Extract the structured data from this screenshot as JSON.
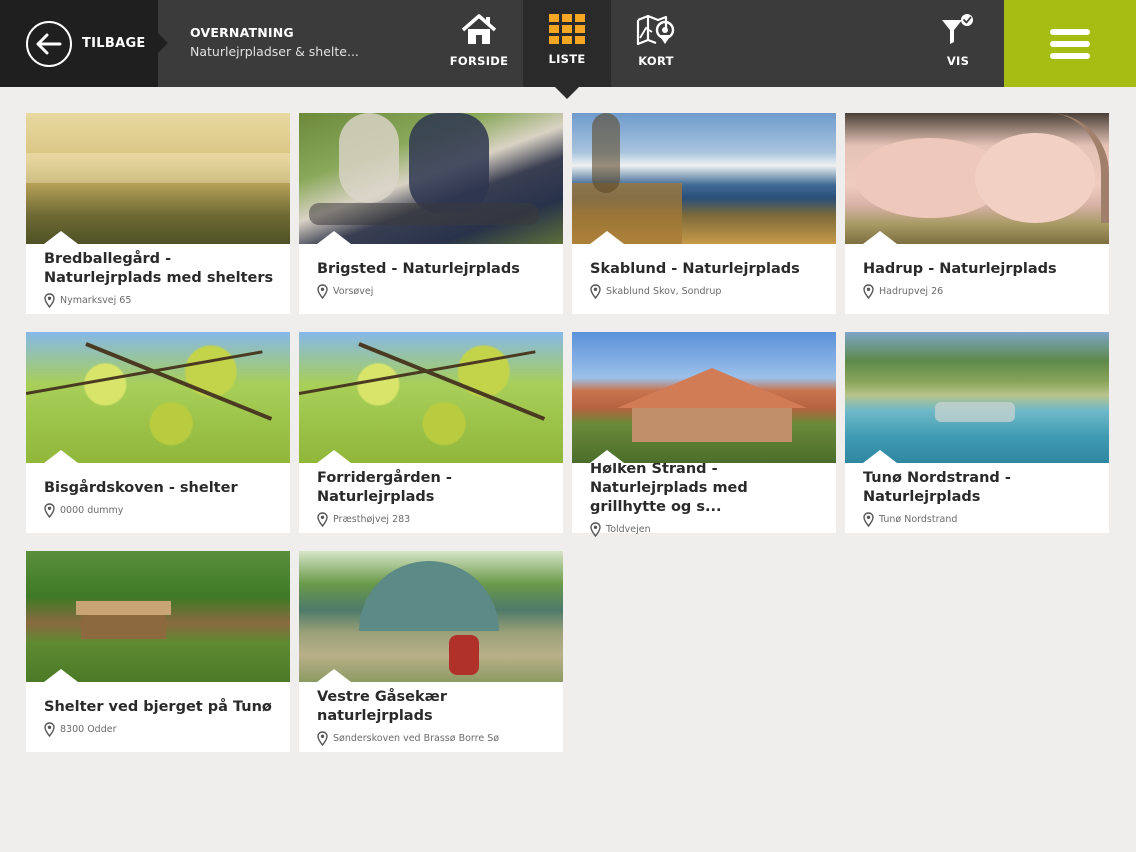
{
  "header": {
    "back_label": "TILBAGE",
    "title": "OVERNATNING",
    "subtitle": "Naturlejrpladser & shelte...",
    "nav": {
      "home": "FORSIDE",
      "list": "LISTE",
      "map": "KORT",
      "filter": "VIS"
    }
  },
  "colors": {
    "header_bg": "#3b3b3b",
    "accent": "#a6bd14",
    "list_active": "#f5a623"
  },
  "cards": [
    {
      "title": "Bredballegård - Naturlejrplads med shelters",
      "address": "Nymarksvej 65"
    },
    {
      "title": "Brigsted - Naturlejrplads",
      "address": "Vorsøvej"
    },
    {
      "title": "Skablund - Naturlejrplads",
      "address": "Skablund Skov, Sondrup"
    },
    {
      "title": "Hadrup - Naturlejrplads",
      "address": "Hadrupvej 26"
    },
    {
      "title": "Bisgårdskoven - shelter",
      "address": "0000 dummy"
    },
    {
      "title": "Forridergården - Naturlejrplads",
      "address": "Præsthøjvej 283"
    },
    {
      "title": "Hølken Strand - Naturlejrplads med grillhytte og s...",
      "address": "Toldvejen"
    },
    {
      "title": "Tunø Nordstrand - Naturlejrplads",
      "address": "Tunø Nordstrand"
    },
    {
      "title": "Shelter ved bjerget på Tunø",
      "address": "8300 Odder"
    },
    {
      "title": "Vestre Gåsekær naturlejrplads",
      "address": "Sønderskoven ved Brassø Borre Sø"
    }
  ]
}
